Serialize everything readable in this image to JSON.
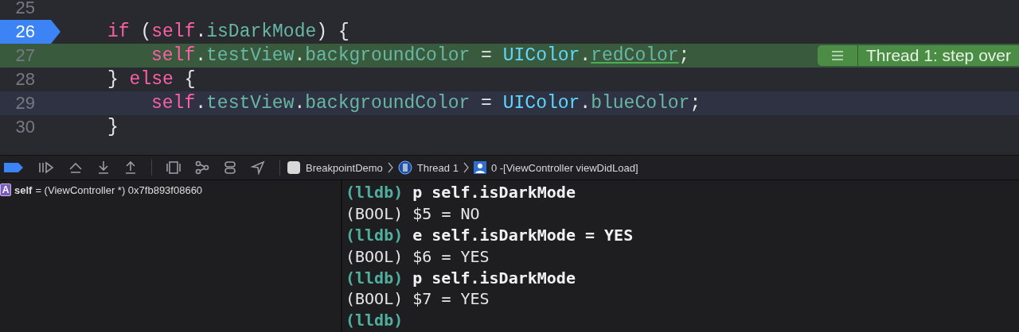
{
  "editor": {
    "lines": [
      {
        "number": "25",
        "breakpoint": false,
        "current_line": false,
        "cursor_line": false
      },
      {
        "number": "26",
        "breakpoint": true,
        "current_line": false,
        "cursor_line": false,
        "tokens": [
          {
            "text": "if",
            "kind": "keyword"
          },
          {
            "text": " (",
            "kind": "plain"
          },
          {
            "text": "self",
            "kind": "keyword"
          },
          {
            "text": ".",
            "kind": "plain"
          },
          {
            "text": "isDarkMode",
            "kind": "property"
          },
          {
            "text": ") {",
            "kind": "plain"
          }
        ],
        "children": [
          {
            "number": "27",
            "breakpoint": false,
            "current_line": true,
            "cursor_line": false,
            "tokens": [
              {
                "text": "self",
                "kind": "keyword"
              },
              {
                "text": ".",
                "kind": "plain"
              },
              {
                "text": "testView",
                "kind": "property"
              },
              {
                "text": ".",
                "kind": "plain"
              },
              {
                "text": "backgroundColor",
                "kind": "property"
              },
              {
                "text": " = ",
                "kind": "plain"
              },
              {
                "text": "UIColor",
                "kind": "type"
              },
              {
                "text": ".",
                "kind": "plain"
              },
              {
                "text": "redColor",
                "kind": "link"
              },
              {
                "text": ";",
                "kind": "plain"
              }
            ],
            "annotation": "Thread 1: step over"
          }
        ]
      },
      {
        "number": "28",
        "breakpoint": false,
        "current_line": false,
        "cursor_line": false,
        "tokens": [
          {
            "text": "} ",
            "kind": "plain"
          },
          {
            "text": "else",
            "kind": "keyword"
          },
          {
            "text": " {",
            "kind": "plain"
          }
        ],
        "children": [
          {
            "number": "29",
            "breakpoint": false,
            "current_line": false,
            "cursor_line": true,
            "tokens": [
              {
                "text": "self",
                "kind": "keyword"
              },
              {
                "text": ".",
                "kind": "plain"
              },
              {
                "text": "testView",
                "kind": "property"
              },
              {
                "text": ".",
                "kind": "plain"
              },
              {
                "text": "backgroundColor",
                "kind": "property"
              },
              {
                "text": " = ",
                "kind": "plain"
              },
              {
                "text": "UIColor",
                "kind": "type"
              },
              {
                "text": ".",
                "kind": "plain"
              },
              {
                "text": "blueColor",
                "kind": "property"
              },
              {
                "text": ";",
                "kind": "plain"
              }
            ]
          }
        ]
      },
      {
        "number": "30",
        "breakpoint": false,
        "current_line": false,
        "cursor_line": false,
        "tokens": [
          {
            "text": "}",
            "kind": "plain"
          }
        ]
      }
    ]
  },
  "debug_bar": {
    "breadcrumbs": [
      {
        "kind": "app",
        "label": "BreakpointDemo"
      },
      {
        "kind": "thread",
        "label": "Thread 1"
      },
      {
        "kind": "frame",
        "label": "0 -[ViewController viewDidLoad]"
      }
    ]
  },
  "variables": [
    {
      "badge": "A",
      "name": "self",
      "value": "= (ViewController *) 0x7fb893f08660"
    }
  ],
  "console": [
    {
      "kind": "input",
      "prompt": "(lldb)",
      "text": "p self.isDarkMode"
    },
    {
      "kind": "output",
      "text": "(BOOL) $5 = NO"
    },
    {
      "kind": "input",
      "prompt": "(lldb)",
      "text": "e self.isDarkMode = YES"
    },
    {
      "kind": "output",
      "text": "(BOOL) $6 = YES"
    },
    {
      "kind": "input",
      "prompt": "(lldb)",
      "text": "p self.isDarkMode"
    },
    {
      "kind": "output",
      "text": "(BOOL) $7 = YES"
    },
    {
      "kind": "input",
      "prompt": "(lldb)"
    }
  ]
}
